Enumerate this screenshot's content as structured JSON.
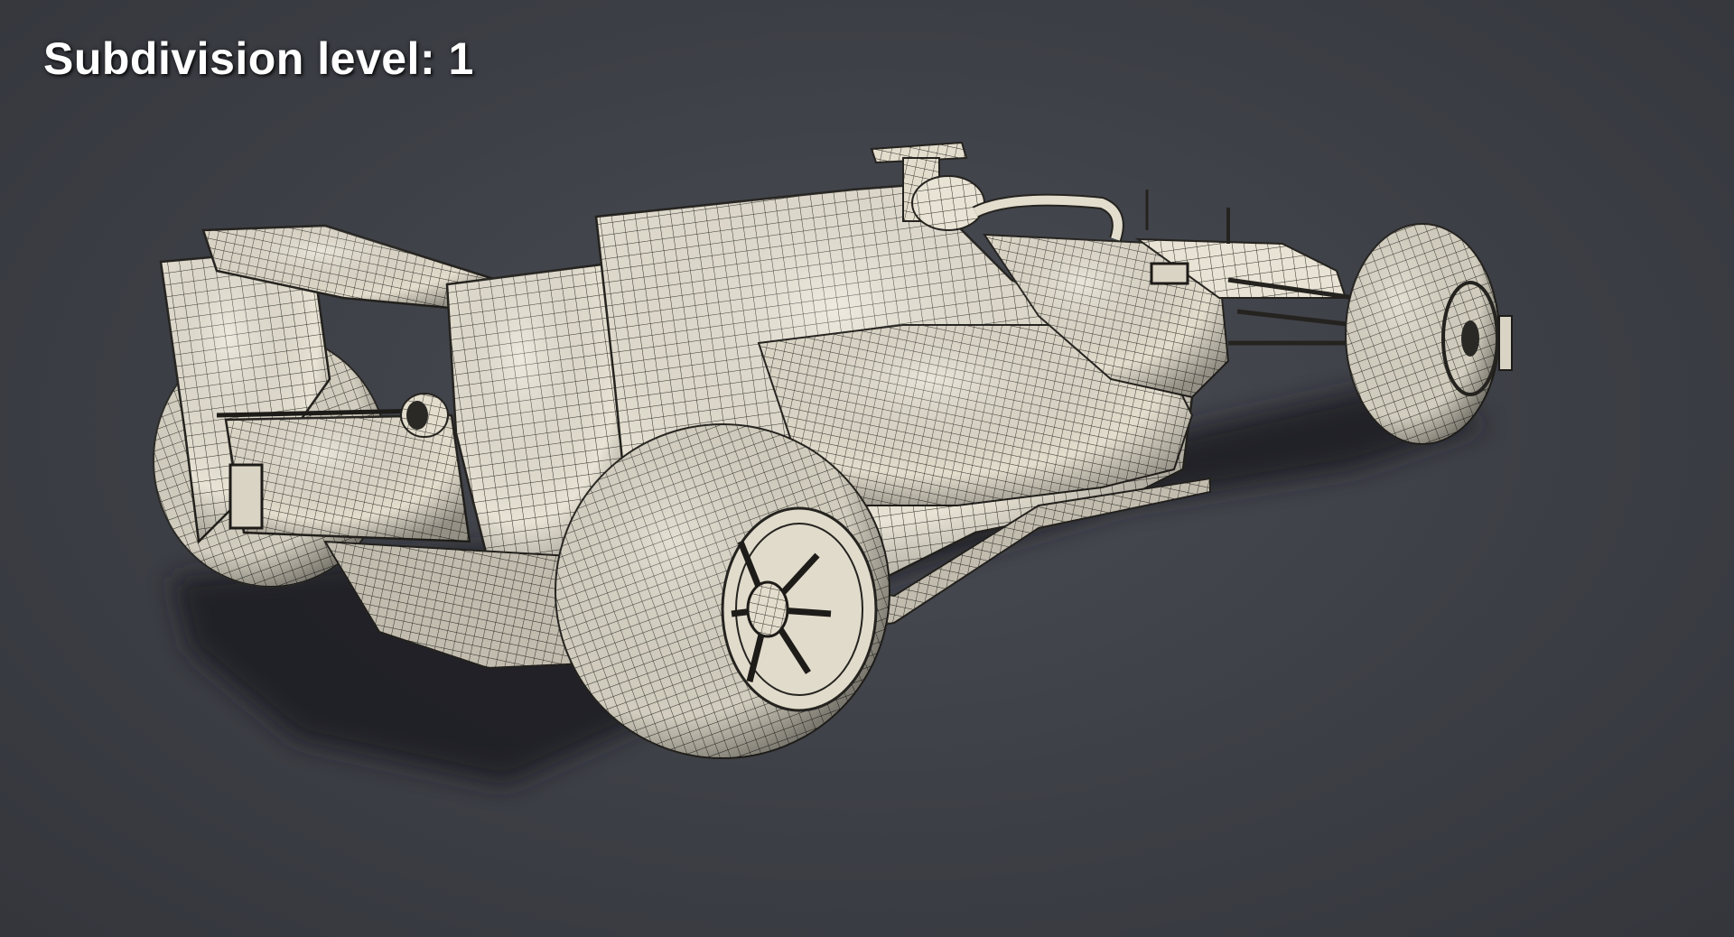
{
  "overlay": {
    "label": "Subdivision level: 1"
  },
  "scene": {
    "subject": "formula-one-car-wireframe-model",
    "background_color": "#3d3f46",
    "mesh_color": "#e6e1d2",
    "wire_color": "#2b2a26",
    "shadow_color": "#1f2024"
  }
}
